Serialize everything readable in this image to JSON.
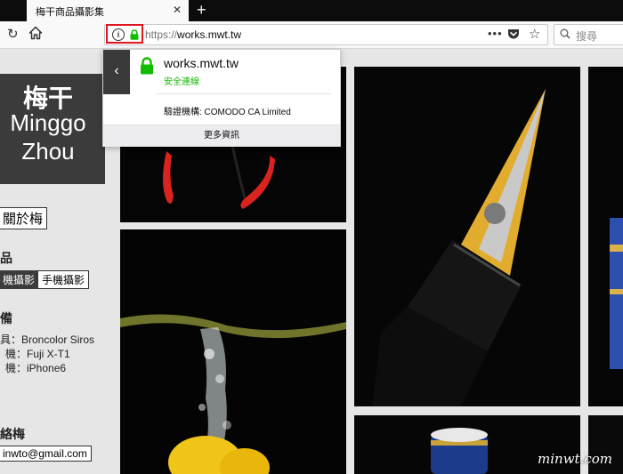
{
  "browser": {
    "tab_title": "梅干商品攝影集",
    "tab_close": "✕",
    "new_tab": "+",
    "url_prefix": "https://",
    "url_host": "works.mwt.tw",
    "search_placeholder": "搜尋",
    "page_actions": "•••"
  },
  "identity_popup": {
    "host": "works.mwt.tw",
    "status": "安全連線",
    "verifier": "驗證機構: COMODO CA Limited",
    "more_info": "更多資訊",
    "back": "‹"
  },
  "sidebar": {
    "logo_cn": "梅干",
    "logo_en_1": "Minggo",
    "logo_en_2": "Zhou",
    "about": "關於梅",
    "works_heading": "品",
    "categories": [
      "機攝影",
      "手機攝影"
    ],
    "gear_heading": "備",
    "gear": [
      "具：Broncolor Siros",
      "機：Fuji X-T1",
      "機：iPhone6"
    ],
    "contact_heading": "絡梅",
    "email": "inwto@gmail.com"
  },
  "watermark": "minwt.com",
  "colors": {
    "highlight_border": "#e0141e",
    "secure_green": "#12bc00",
    "logo_bg": "#3b3b3b"
  }
}
